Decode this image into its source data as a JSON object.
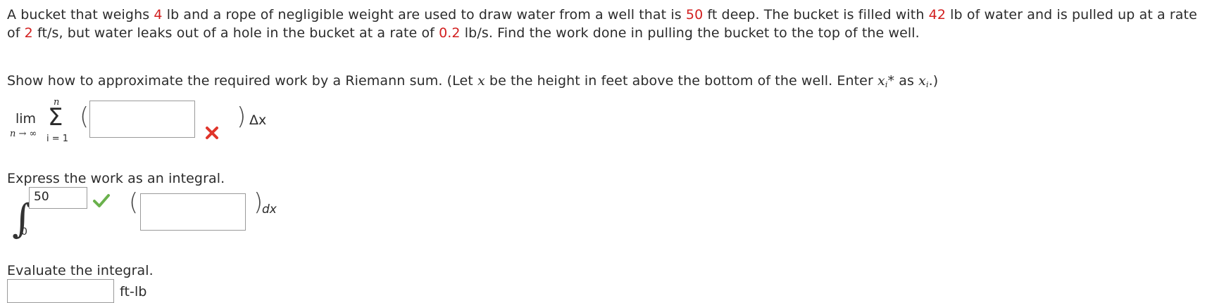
{
  "problem": {
    "p1": "A bucket that weighs ",
    "bucket_weight": "4",
    "p2": " lb and a rope of negligible weight are used to draw water from a well that is ",
    "well_depth": "50",
    "p3": " ft deep. The bucket is filled with ",
    "water_weight": "42",
    "p4": " lb of water and is pulled up at a rate of ",
    "pull_rate": "2",
    "p5": " ft/s, but water leaks out of a hole in the bucket at a rate of ",
    "leak_rate": "0.2",
    "p6": " lb/s. Find the work done in pulling the bucket to the top of the well."
  },
  "part1": {
    "prompt_a": "Show how to approximate the required work by a Riemann sum. (Let ",
    "var_x": "x",
    "prompt_b": " be the height in feet above the bottom of the well. Enter ",
    "xi_star": "x",
    "xi_star_sub": "i",
    "star": "*",
    "prompt_c": " as ",
    "xi": "x",
    "xi_sub": "i",
    "prompt_d": ".)",
    "lim": "lim",
    "lim_under": "n → ∞",
    "sigma": "Σ",
    "sum_upper": "n",
    "sum_lower": "i = 1",
    "open_paren": "(",
    "close_paren": ")",
    "delta_x": "Δx",
    "riemann_answer": "",
    "status_icon": "x-mark-icon",
    "status_color": "#e0352b"
  },
  "part2": {
    "prompt": "Express the work as an integral.",
    "upper_limit": "50",
    "lower_limit": "0",
    "integral_sign": "∫",
    "integrand_answer": "",
    "open_paren": "(",
    "close_paren": ")",
    "dx": "dx",
    "status_icon": "check-mark-icon",
    "status_color": "#6ab14c"
  },
  "part3": {
    "prompt": "Evaluate the integral.",
    "answer": "",
    "unit": "ft-lb"
  }
}
